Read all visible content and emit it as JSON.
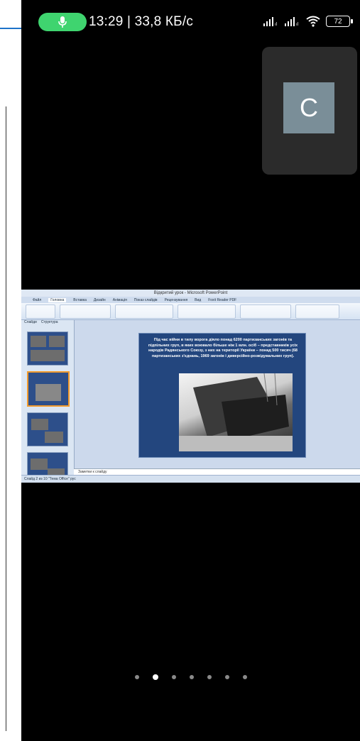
{
  "status_bar": {
    "time_speed": "13:29 | 33,8 КБ/с",
    "battery": "72",
    "colors": {
      "mic_pill": "#3fd46f"
    }
  },
  "participant": {
    "initial": "C",
    "avatar_color": "#7a8e98"
  },
  "shared_screen": {
    "window_title": "Відкритий урок - Microsoft PowerPoint",
    "tabs": [
      "Файл",
      "Головна",
      "Вставка",
      "Дизайн",
      "Анімація",
      "Показ слайдів",
      "Рецензування",
      "Вид",
      "Foxit Reader PDF"
    ],
    "panel_tabs": [
      "Слайди",
      "Структура"
    ],
    "slide_text": "Під час війни в тилу ворога діяло понад 6200 партизанських загонів та підпільних груп, в яких воювало більше ніж 1 млн. осіб – представників усіх народів Радянського Союзу, з них на території України – понад 500 тисяч (68 партизанських з'єднань, 1969 загонів і диверсійно-розвідувальних груп).",
    "notes_placeholder": "Заметки к слайду",
    "status_line": "Слайд 2 из 10    \"Тема Office\"    рус"
  },
  "pager": {
    "count": 7,
    "active_index": 1
  }
}
